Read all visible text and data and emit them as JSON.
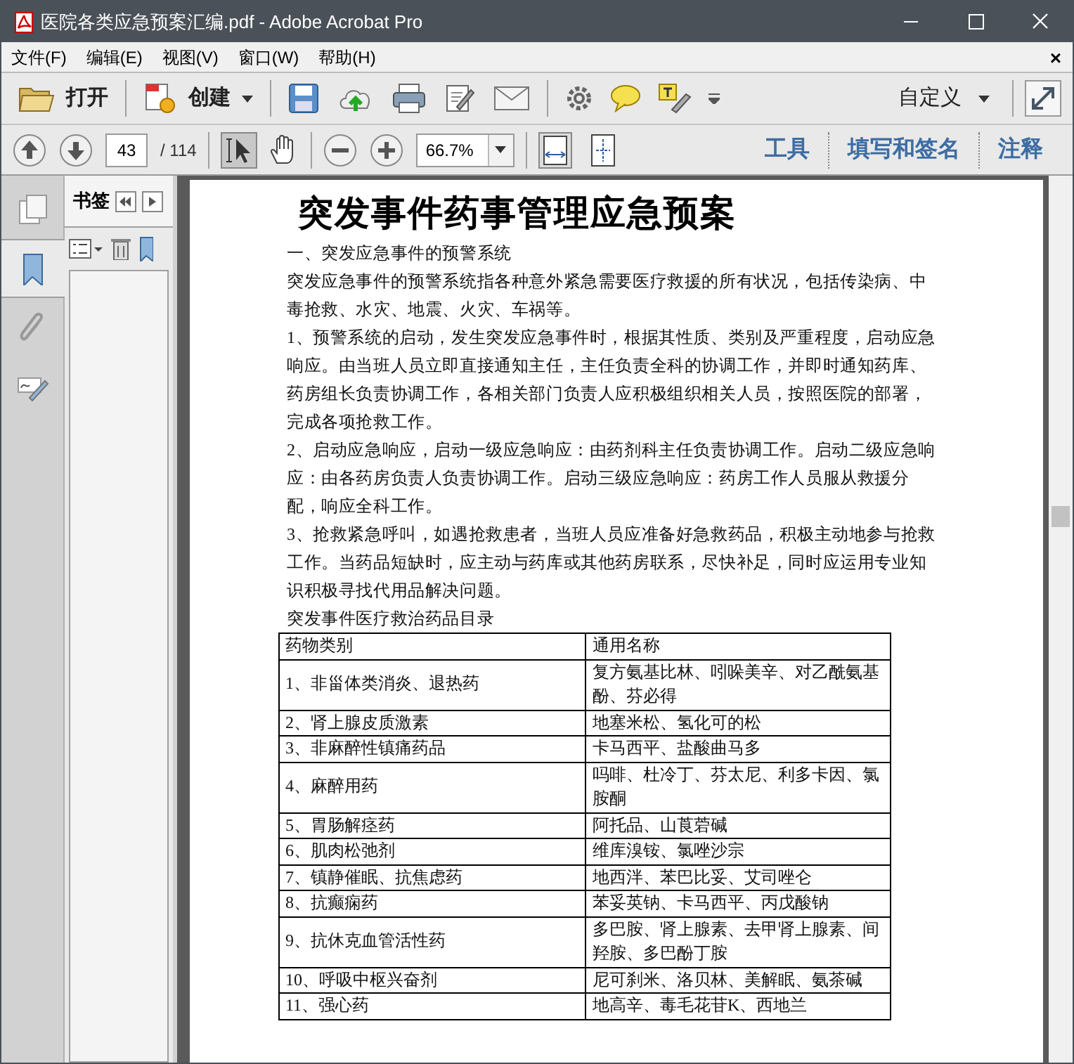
{
  "window": {
    "title": "医院各类应急预案汇编.pdf - Adobe Acrobat Pro"
  },
  "menu": {
    "items": [
      "文件(F)",
      "编辑(E)",
      "视图(V)",
      "窗口(W)",
      "帮助(H)"
    ],
    "close": "×"
  },
  "toolbar": {
    "open": "打开",
    "create": "创建",
    "customize": "自定义"
  },
  "navigation": {
    "page": "43",
    "page_total": "/ 114",
    "zoom": "66.7%",
    "select_tool_active": true,
    "panes": [
      "工具",
      "填写和签名",
      "注释"
    ]
  },
  "side_tabs": [
    {
      "kind": "pages",
      "selected": false
    },
    {
      "kind": "bookmarks",
      "selected": true
    },
    {
      "kind": "attachments",
      "selected": false
    },
    {
      "kind": "signatures",
      "selected": false
    }
  ],
  "bookmarks_panel": {
    "title": "书签"
  },
  "document": {
    "title": "突发事件药事管理应急预案",
    "paragraphs": [
      "一、突发应急事件的预警系统",
      "突发应急事件的预警系统指各种意外紧急需要医疗救援的所有状况，包括传染病、中毒抢救、水灾、地震、火灾、车祸等。",
      "1、预警系统的启动，发生突发应急事件时，根据其性质、类别及严重程度，启动应急响应。由当班人员立即直接通知主任，主任负责全科的协调工作，并即时通知药库、药房组长负责协调工作，各相关部门负责人应积极组织相关人员，按照医院的部署，完成各项抢救工作。",
      "2、启动应急响应，启动一级应急响应：由药剂科主任负责协调工作。启动二级应急响应：由各药房负责人负责协调工作。启动三级应急响应：药房工作人员服从救援分配，响应全科工作。",
      "3、抢救紧急呼叫，如遇抢救患者，当班人员应准备好急救药品，积极主动地参与抢救工作。当药品短缺时，应主动与药库或其他药房联系，尽快补足，同时应运用专业知识积极寻找代用品解决问题。",
      "突发事件医疗救治药品目录"
    ],
    "table": {
      "columns": [
        "药物类别",
        "通用名称"
      ],
      "rows": [
        [
          "1、非甾体类消炎、退热药",
          "复方氨基比林、吲哚美辛、对乙酰氨基酚、芬必得"
        ],
        [
          "2、肾上腺皮质激素",
          "地塞米松、氢化可的松"
        ],
        [
          "3、非麻醉性镇痛药品",
          "卡马西平、盐酸曲马多"
        ],
        [
          "4、麻醉用药",
          "吗啡、杜冷丁、芬太尼、利多卡因、氯胺酮"
        ],
        [
          "5、胃肠解痉药",
          "阿托品、山莨菪碱"
        ],
        [
          "6、肌肉松弛剂",
          "维库溴铵、氯唑沙宗"
        ],
        [
          "7、镇静催眠、抗焦虑药",
          "地西泮、苯巴比妥、艾司唑仑"
        ],
        [
          "8、抗癫痫药",
          "苯妥英钠、卡马西平、丙戊酸钠"
        ],
        [
          "9、抗休克血管活性药",
          "多巴胺、肾上腺素、去甲肾上腺素、间羟胺、多巴酚丁胺"
        ],
        [
          "10、呼吸中枢兴奋剂",
          "尼可刹米、洛贝林、美解眠、氨茶碱"
        ],
        [
          "11、强心药",
          "地高辛、毒毛花苷K、西地兰"
        ]
      ]
    }
  }
}
